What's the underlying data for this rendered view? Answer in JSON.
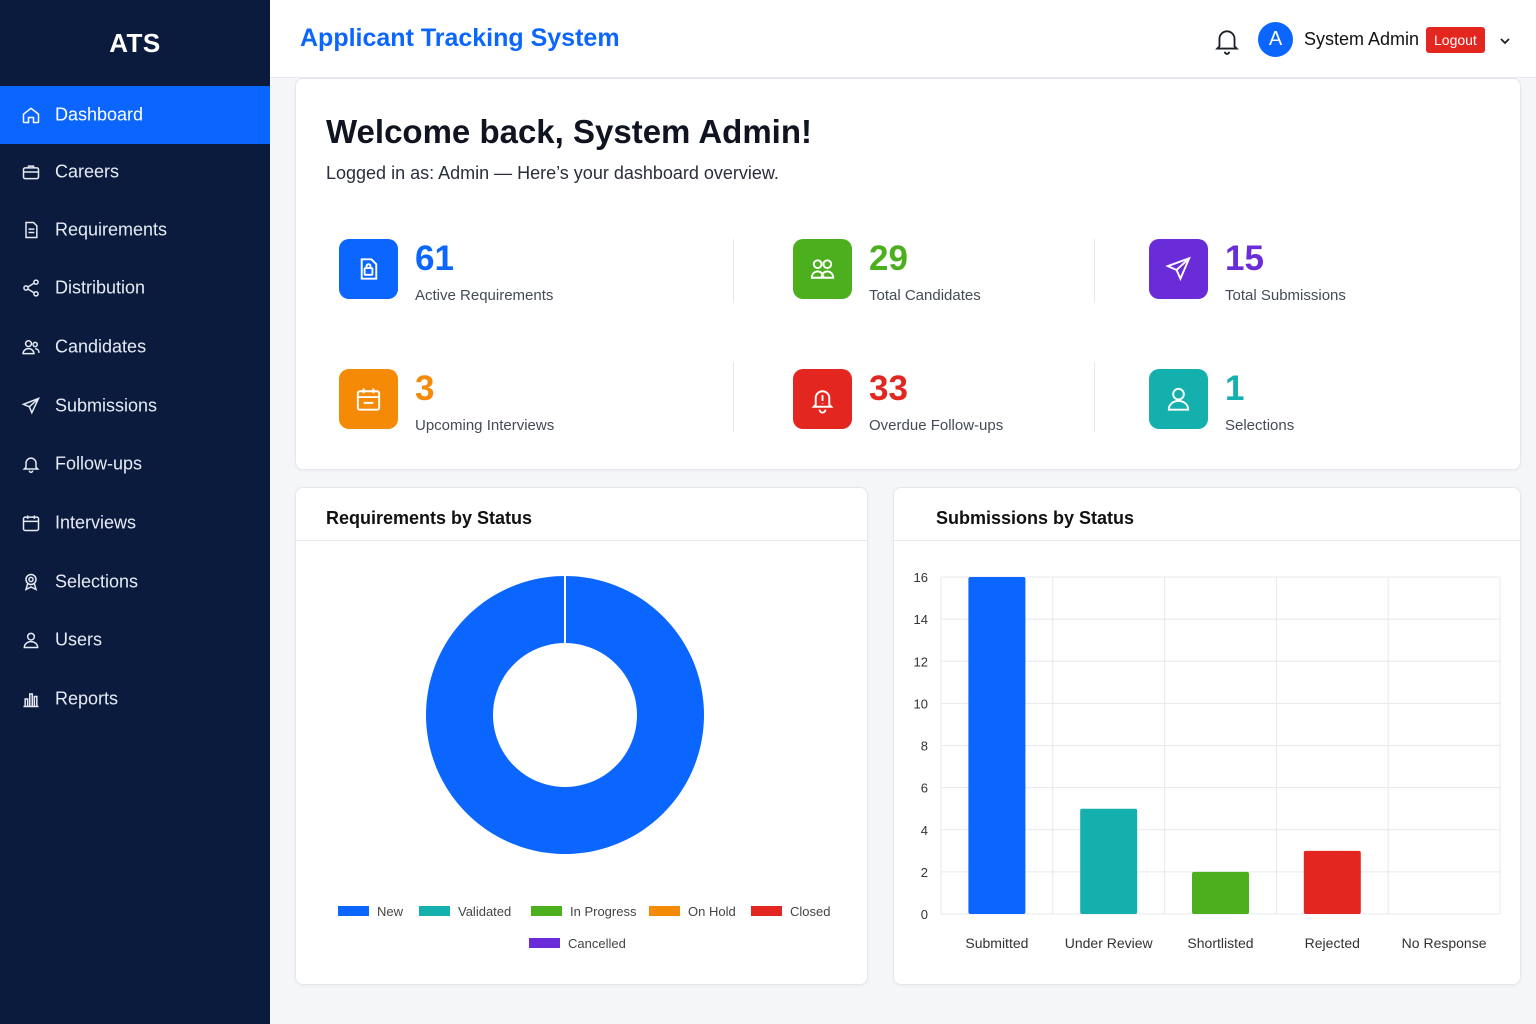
{
  "sidebar": {
    "brand": "ATS",
    "items": [
      {
        "label": "Dashboard",
        "icon": "home-icon",
        "active": true
      },
      {
        "label": "Careers",
        "icon": "briefcase-icon"
      },
      {
        "label": "Requirements",
        "icon": "document-icon"
      },
      {
        "label": "Distribution",
        "icon": "share-icon"
      },
      {
        "label": "Candidates",
        "icon": "users-icon"
      },
      {
        "label": "Submissions",
        "icon": "send-icon"
      },
      {
        "label": "Follow-ups",
        "icon": "bell-icon"
      },
      {
        "label": "Interviews",
        "icon": "calendar-icon"
      },
      {
        "label": "Selections",
        "icon": "award-icon"
      },
      {
        "label": "Users",
        "icon": "user-icon"
      },
      {
        "label": "Reports",
        "icon": "bar-chart-icon"
      }
    ]
  },
  "header": {
    "title": "Applicant Tracking System",
    "avatar_initial": "A",
    "user_name": "System Admin",
    "logout_label": "Logout"
  },
  "welcome": {
    "title": "Welcome back, System Admin!",
    "subtitle": "Logged in as: Admin — Here’s your dashboard overview."
  },
  "stats": [
    {
      "value": "61",
      "label": "Active Requirements",
      "color": "#0a66ff",
      "icon": "requirements-icon"
    },
    {
      "value": "29",
      "label": "Total Candidates",
      "color": "#4caf1e",
      "icon": "candidates-icon"
    },
    {
      "value": "15",
      "label": "Total Submissions",
      "color": "#6a2bd8",
      "icon": "send-icon"
    },
    {
      "value": "3",
      "label": "Upcoming Interviews",
      "color": "#f58a07",
      "icon": "calendar-icon"
    },
    {
      "value": "33",
      "label": "Overdue Follow-ups",
      "color": "#e3261f",
      "icon": "alert-icon"
    },
    {
      "value": "1",
      "label": "Selections",
      "color": "#14b0ae",
      "icon": "user-icon"
    }
  ],
  "requirements_panel": {
    "title": "Requirements by Status"
  },
  "submissions_panel": {
    "title": "Submissions by Status"
  },
  "chart_data": [
    {
      "type": "pie",
      "title": "Requirements by Status",
      "donut": true,
      "categories": [
        "New",
        "Validated",
        "In Progress",
        "On Hold",
        "Closed",
        "Cancelled"
      ],
      "values": [
        61,
        0,
        0,
        0,
        0,
        0
      ],
      "colors": [
        "#0a66ff",
        "#14b0ae",
        "#4caf1e",
        "#f58a07",
        "#e3261f",
        "#6a2bd8"
      ],
      "legend": "bottom"
    },
    {
      "type": "bar",
      "title": "Submissions by Status",
      "categories": [
        "Submitted",
        "Under Review",
        "Shortlisted",
        "Rejected",
        "No Response"
      ],
      "values": [
        16,
        5,
        2,
        3,
        0
      ],
      "colors": [
        "#0a66ff",
        "#14b0ae",
        "#4caf1e",
        "#e3261f",
        "#6a2bd8"
      ],
      "yticks": [
        "0",
        "2",
        "4",
        "6",
        "8",
        "10",
        "12",
        "14",
        "16"
      ],
      "ylim": [
        0,
        16
      ],
      "grid": true
    }
  ]
}
